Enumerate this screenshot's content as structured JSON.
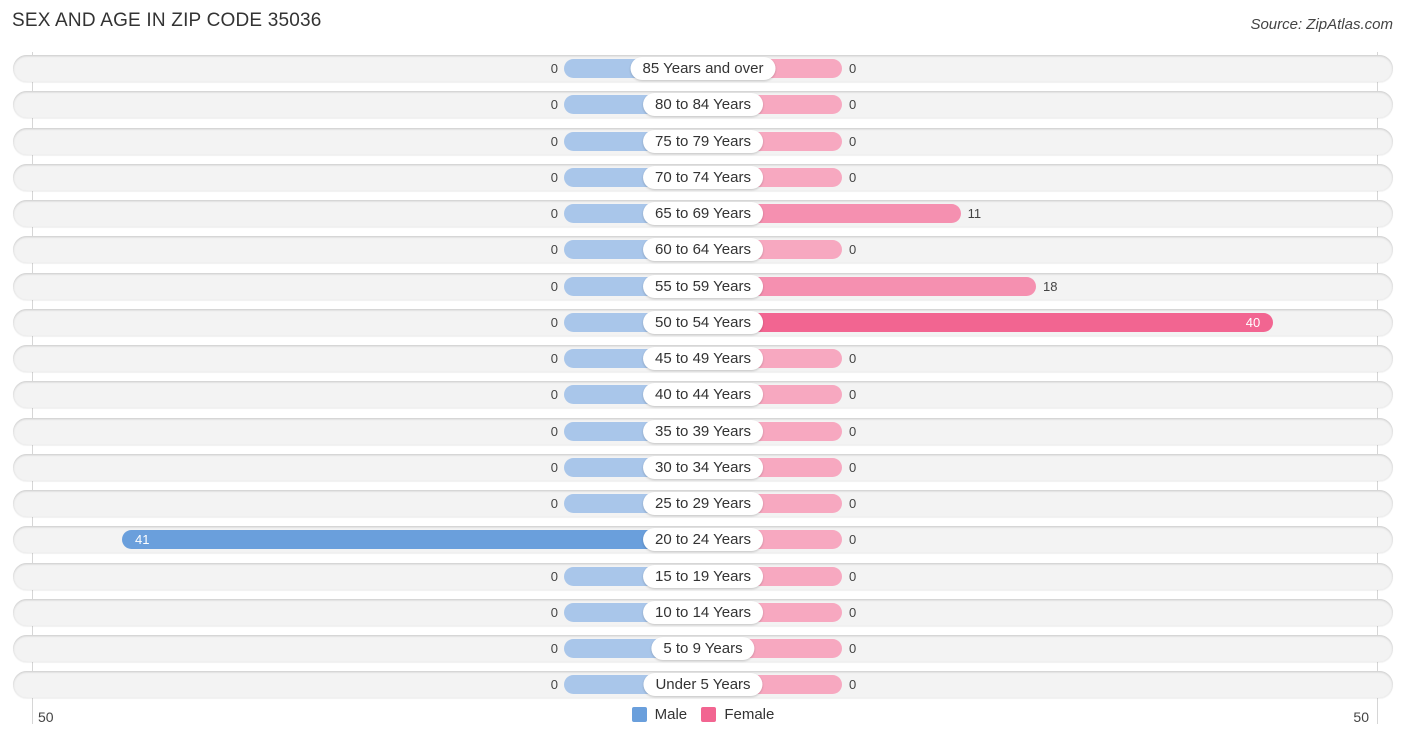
{
  "header": {
    "title": "SEX AND AGE IN ZIP CODE 35036",
    "source": "Source: ZipAtlas.com"
  },
  "chart_data": {
    "type": "bar",
    "orientation": "horizontal-diverging",
    "title": "SEX AND AGE IN ZIP CODE 35036",
    "categories": [
      "85 Years and over",
      "80 to 84 Years",
      "75 to 79 Years",
      "70 to 74 Years",
      "65 to 69 Years",
      "60 to 64 Years",
      "55 to 59 Years",
      "50 to 54 Years",
      "45 to 49 Years",
      "40 to 44 Years",
      "35 to 39 Years",
      "30 to 34 Years",
      "25 to 29 Years",
      "20 to 24 Years",
      "15 to 19 Years",
      "10 to 14 Years",
      "5 to 9 Years",
      "Under 5 Years"
    ],
    "series": [
      {
        "name": "Male",
        "color": "#6a9fdc",
        "light_color": "#a9c6ea",
        "values": [
          0,
          0,
          0,
          0,
          0,
          0,
          0,
          0,
          0,
          0,
          0,
          0,
          0,
          41,
          0,
          0,
          0,
          0
        ]
      },
      {
        "name": "Female",
        "color": "#f26591",
        "light_color": "#f7a8c0",
        "values": [
          0,
          0,
          0,
          0,
          11,
          0,
          18,
          40,
          0,
          0,
          0,
          0,
          0,
          0,
          0,
          0,
          0,
          0
        ]
      }
    ],
    "xlim": [
      -50,
      50
    ],
    "axis_tick_labels": {
      "left": "50",
      "right": "50"
    },
    "legend": {
      "position": "bottom-center",
      "entries": [
        "Male",
        "Female"
      ]
    }
  }
}
